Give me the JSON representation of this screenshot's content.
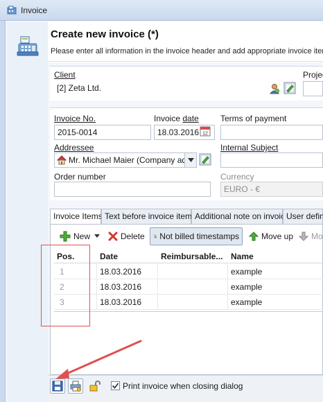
{
  "window": {
    "title": "Invoice"
  },
  "header": {
    "title": "Create new invoice (*)",
    "subtitle": "Please enter all information in the invoice header and add appropriate invoice items"
  },
  "client": {
    "label": "Client",
    "value": "[2] Zeta Ltd.",
    "project_label": "Projec"
  },
  "invoice": {
    "number_label": "Invoice No.",
    "number_value": "2015-0014",
    "date_label_pre": "Invoice ",
    "date_label_u": "date",
    "date_value": "18.03.2016",
    "terms_label": "Terms of payment",
    "terms_value": "",
    "addressee_label": "Addressee",
    "addressee_value": "Mr. Michael Maier (Company addre",
    "internal_subject_label": "Internal Subject",
    "internal_subject_value": "",
    "order_number_label": "Order number",
    "order_number_value": "",
    "currency_label": "Currency",
    "currency_value": "EURO - €"
  },
  "tabs": [
    {
      "label": "Invoice Items"
    },
    {
      "label": "Text before invoice items"
    },
    {
      "label": "Additional note on invoice"
    },
    {
      "label": "User define"
    }
  ],
  "toolbar": {
    "new_label": "New",
    "delete_label": "Delete",
    "not_billed_label": "Not billed timestamps",
    "move_up_label": "Move up",
    "move_down_label": "Mov"
  },
  "grid": {
    "columns": [
      "Pos.",
      "Date",
      "Reimbursable...",
      "Name"
    ],
    "rows": [
      {
        "pos": "1",
        "date": "18.03.2016",
        "reimbursable": "",
        "name": "example"
      },
      {
        "pos": "2",
        "date": "18.03.2016",
        "reimbursable": "",
        "name": "example"
      },
      {
        "pos": "3",
        "date": "18.03.2016",
        "reimbursable": "",
        "name": "example"
      }
    ]
  },
  "bottom": {
    "print_label": "Print invoice when closing dialog",
    "print_checked": true
  },
  "colors": {
    "accent_red": "#e05050",
    "titlebar": "#c9d9ee"
  }
}
